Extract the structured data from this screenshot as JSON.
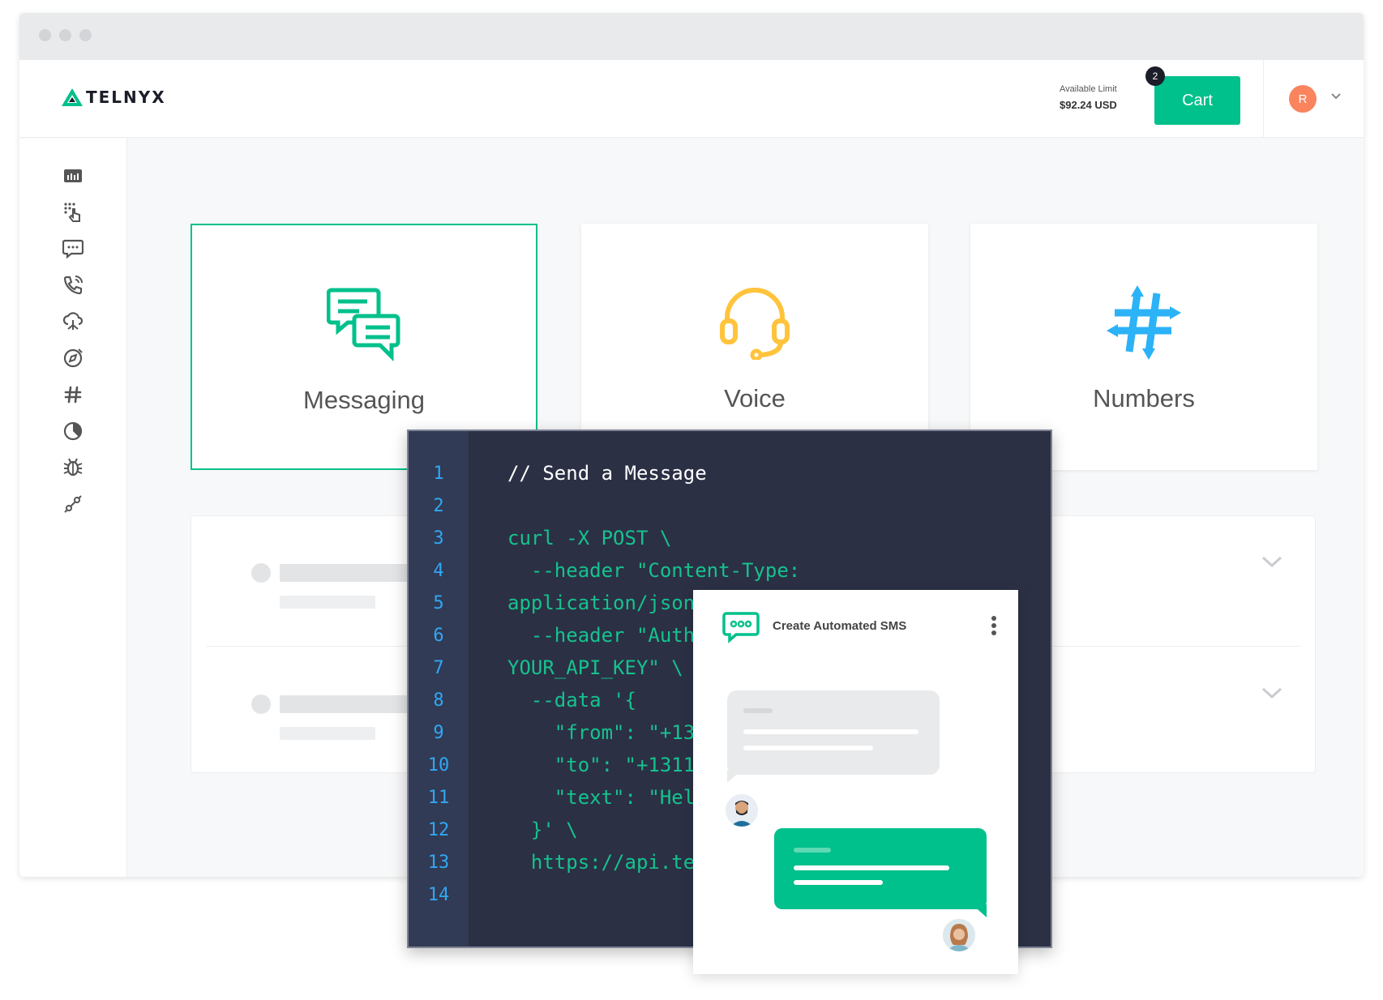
{
  "header": {
    "brand": "TELNYX",
    "limit_label": "Available Limit",
    "limit_value": "$92.24 USD",
    "cart_label": "Cart",
    "cart_count": "2",
    "user_initial": "R"
  },
  "cards": [
    {
      "label": "Messaging",
      "icon": "messaging-icon",
      "color": "#00c08b"
    },
    {
      "label": "Voice",
      "icon": "headset-icon",
      "color": "#ffc33c"
    },
    {
      "label": "Numbers",
      "icon": "hashtag-icon",
      "color": "#2bb2f7"
    }
  ],
  "sidebar": {
    "icons": [
      "dashboard-icon",
      "touch-dialpad-icon",
      "chat-icon",
      "phone-call-icon",
      "cloud-network-icon",
      "compass-icon",
      "hashtag-icon",
      "pie-chart-icon",
      "bug-icon",
      "settings-tool-icon"
    ]
  },
  "editor": {
    "line_numbers": [
      "1",
      "2",
      "3",
      "4",
      "5",
      "6",
      "7",
      "8",
      "9",
      "10",
      "11",
      "12",
      "13",
      "14"
    ],
    "lines": [
      "// Send a Message",
      "",
      "curl -X POST \\",
      "  --header \"Content-Type:",
      "application/json",
      "  --header \"Auth",
      "YOUR_API_KEY\" \\",
      "  --data '{",
      "    \"from\": \"+13",
      "    \"to\": \"+1311",
      "    \"text\": \"Hel",
      "  }' \\",
      "  https://api.te",
      ""
    ]
  },
  "sms": {
    "title": "Create Automated SMS"
  },
  "colors": {
    "accent": "#00c08b",
    "editor_bg": "#2b3045",
    "line_number": "#31a7f5"
  }
}
